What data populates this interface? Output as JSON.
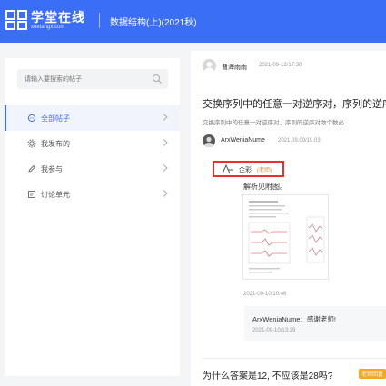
{
  "header": {
    "logo_text": "学堂在线",
    "logo_sub": "xuetangx.com",
    "course_title": "数据结构(上)(2021秋)"
  },
  "sidebar": {
    "search_placeholder": "请输入要搜索的帖子",
    "items": [
      {
        "label": "全部帖子",
        "icon": "chat-bubble-icon",
        "active": true
      },
      {
        "label": "我发布的",
        "icon": "gear-icon",
        "active": false
      },
      {
        "label": "我参与",
        "icon": "edit-icon",
        "active": false
      },
      {
        "label": "讨论单元",
        "icon": "folder-icon",
        "active": false
      }
    ]
  },
  "post": {
    "author": "曹海雨雨",
    "date": "2021-09-12/17:30",
    "title": "交换序列中的任意一对逆序对，序列的逆序",
    "excerpt": "交换序列中的任意一对逆序对，序列的逆序对数个数必",
    "reply": {
      "author": "ArxWeniaNume",
      "date": "2021.09.09/19.03"
    },
    "answer": {
      "user": "企彩",
      "badge": "(老师)",
      "body": "解析见附图。",
      "time": "2021-09-10/10.46",
      "sub_reply": {
        "text": "ArxWeniaNume：感谢老师!",
        "date": "2021-09-10/13:29"
      }
    }
  },
  "next_post": {
    "title": "为什么答案是12, 不应该是28吗?",
    "badge": "老师回复"
  },
  "colors": {
    "primary": "#3a6ff5",
    "highlight": "#e5322d",
    "badge": "#f5a623"
  }
}
